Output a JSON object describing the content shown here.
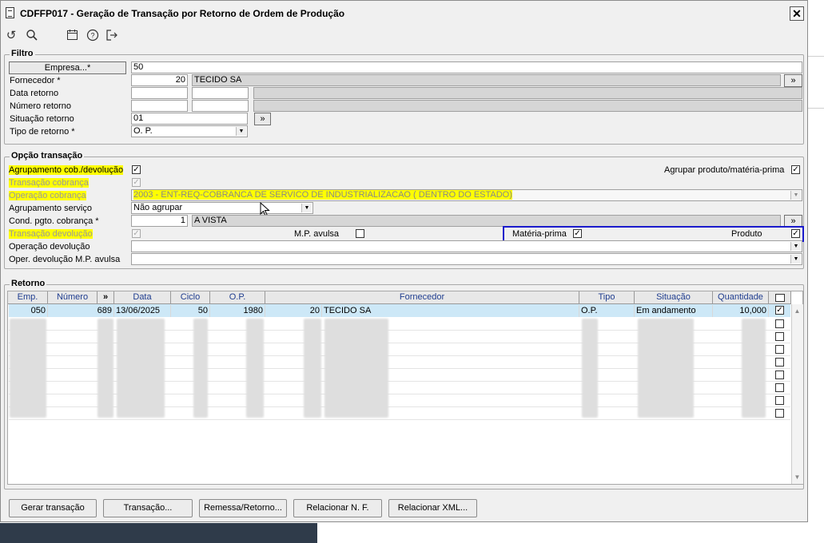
{
  "window": {
    "title": "CDFFP017 - Geração de Transação por Retorno de Ordem de Produção",
    "close": "✕"
  },
  "toolbar": {
    "undo_icon": "undo-icon",
    "search_icon": "search-icon",
    "calendar_icon": "calendar-icon",
    "help_icon": "help-icon",
    "exit_icon": "exit-icon"
  },
  "filtro": {
    "legend": "Filtro",
    "empresa_button": "Empresa...*",
    "empresa_value": "50",
    "fornecedor_label": "Fornecedor *",
    "fornecedor_code": "20",
    "fornecedor_name": "TECIDO SA",
    "data_retorno_label": "Data retorno",
    "numero_retorno_label": "Número retorno",
    "situacao_label": "Situação retorno",
    "situacao_value": "01",
    "tipo_label": "Tipo de retorno *",
    "tipo_value": "O. P.",
    "expand": "»"
  },
  "opcao": {
    "legend": "Opção transação",
    "agrupamento_cob_label": "Agrupamento cob./devolução",
    "agrupar_produto_label": "Agrupar produto/matéria-prima",
    "transacao_cobranca_label": "Transação cobrança",
    "operacao_cobranca_label": "Operação cobrança",
    "operacao_cobranca_value": "2003 - ENT-REQ-COBRANCA DE SERVICO DE INDUSTRIALIZACAO ( DENTRO DO ESTADO)",
    "agrupamento_servico_label": "Agrupamento serviço",
    "agrupamento_servico_value": "Não agrupar",
    "cond_pgto_label": "Cond. pgto. cobrança *",
    "cond_pgto_code": "1",
    "cond_pgto_name": "A VISTA",
    "transacao_devolucao_label": "Transação devolução",
    "mp_avulsa_label": "M.P. avulsa",
    "materia_prima_label": "Matéria-prima",
    "produto_label": "Produto",
    "operacao_devolucao_label": "Operação devolução",
    "oper_devolucao_mp_label": "Oper. devolução M.P. avulsa",
    "check": "✓"
  },
  "retorno": {
    "legend": "Retorno",
    "columns": [
      "Emp.",
      "Número",
      "»",
      "Data",
      "Ciclo",
      "O.P.",
      "Fornecedor",
      "Tipo",
      "Situação",
      "Quantidade"
    ],
    "row": {
      "emp": "050",
      "numero": "689",
      "data": "13/06/2025",
      "ciclo": "50",
      "op": "1980",
      "forn_code": "20",
      "forn_name": "TECIDO SA",
      "tipo": "O.P.",
      "situacao": "Em andamento",
      "quantidade": "10,000"
    }
  },
  "buttons": {
    "gerar": "Gerar transação",
    "transacao": "Transação...",
    "remessa": "Remessa/Retorno...",
    "relacionar_nf": "Relacionar N. F.",
    "relacionar_xml": "Relacionar XML..."
  },
  "colors": {
    "highlight": "#ffff00",
    "selection_box": "#1a1acc",
    "grid_header_text": "#1f3d8f",
    "selected_row": "#cde8f7"
  }
}
